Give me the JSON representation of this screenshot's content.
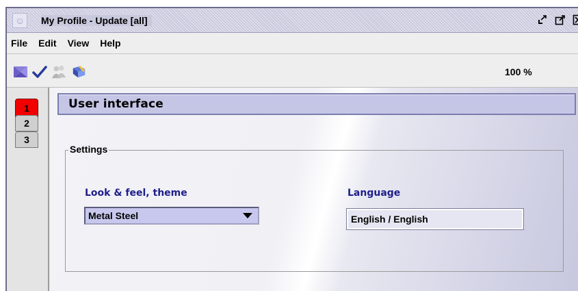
{
  "window": {
    "title": "My Profile - Update [all]",
    "buttons": [
      "minimize-icon",
      "maximize-icon",
      "close-icon"
    ]
  },
  "menu": {
    "items": [
      "File",
      "Edit",
      "View",
      "Help"
    ]
  },
  "toolbar": {
    "tools": [
      "cancel-icon",
      "confirm-check-icon",
      "users-icon",
      "book-edit-icon"
    ],
    "zoom": "100 %"
  },
  "tabs": {
    "items": [
      "1",
      "2",
      "3"
    ],
    "active_tab": "1"
  },
  "panel": {
    "title": "User interface",
    "settings_legend": "Settings",
    "look_feel_label": "Look & feel, theme",
    "look_feel_value": "Metal Steel",
    "language_label": "Language",
    "language_value": "English / English"
  },
  "colors": {
    "header_bar": "#c5c5e6",
    "active_tab": "#f20000",
    "label_blue": "#1e1e8c",
    "select_bg": "#c8c8ee"
  }
}
